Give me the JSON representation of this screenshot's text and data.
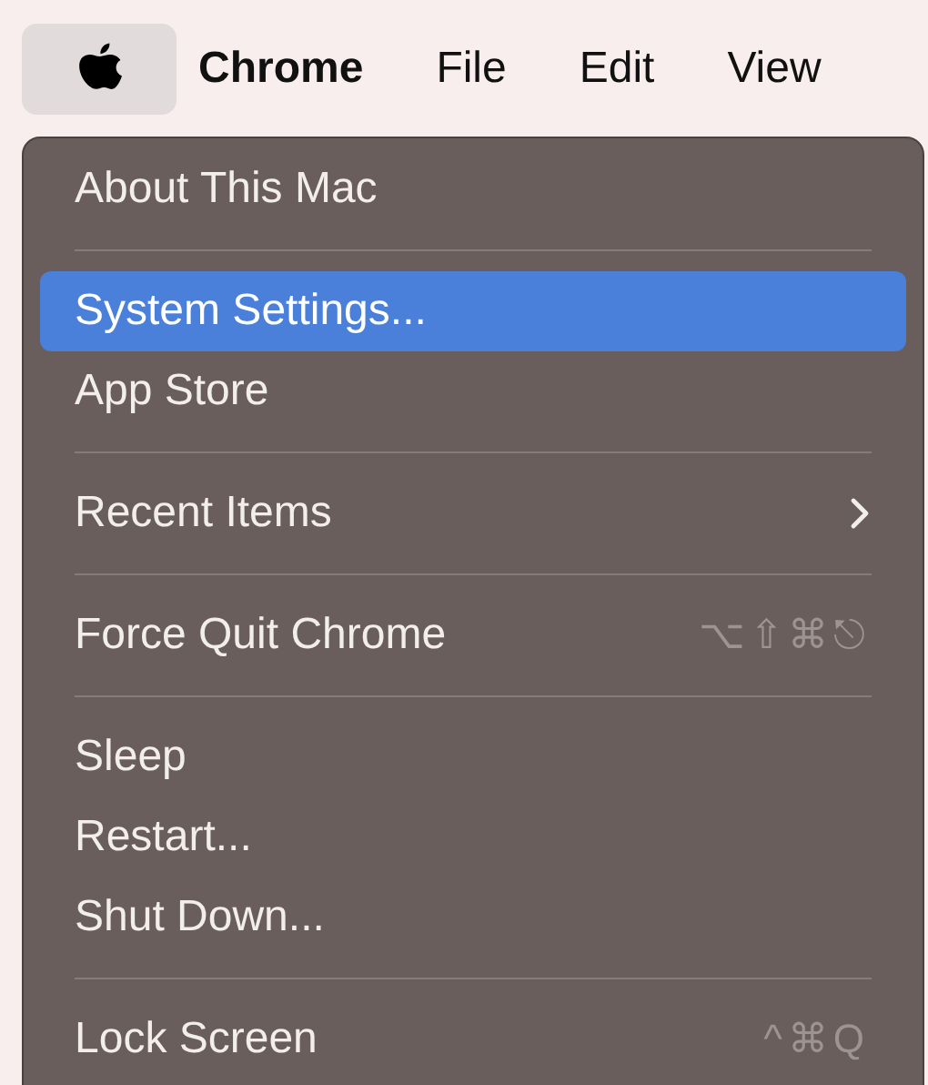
{
  "menu_bar": {
    "apple_menu_open": true,
    "items": [
      {
        "label": "Chrome",
        "bold": true
      },
      {
        "label": "File",
        "bold": false
      },
      {
        "label": "Edit",
        "bold": false
      },
      {
        "label": "View",
        "bold": false
      }
    ]
  },
  "menu": {
    "items": [
      {
        "kind": "item",
        "label": "About This Mac",
        "selected": false
      },
      {
        "kind": "separator"
      },
      {
        "kind": "item",
        "label": "System Settings...",
        "selected": true
      },
      {
        "kind": "item",
        "label": "App Store",
        "selected": false
      },
      {
        "kind": "separator"
      },
      {
        "kind": "item",
        "label": "Recent Items",
        "selected": false,
        "submenu": true
      },
      {
        "kind": "separator"
      },
      {
        "kind": "item",
        "label": "Force Quit Chrome",
        "selected": false,
        "shortcut": "⌥⇧⌘⎋"
      },
      {
        "kind": "separator"
      },
      {
        "kind": "item",
        "label": "Sleep",
        "selected": false
      },
      {
        "kind": "item",
        "label": "Restart...",
        "selected": false
      },
      {
        "kind": "item",
        "label": "Shut Down...",
        "selected": false
      },
      {
        "kind": "separator"
      },
      {
        "kind": "item",
        "label": "Lock Screen",
        "selected": false,
        "shortcut": "^⌘Q"
      }
    ]
  }
}
